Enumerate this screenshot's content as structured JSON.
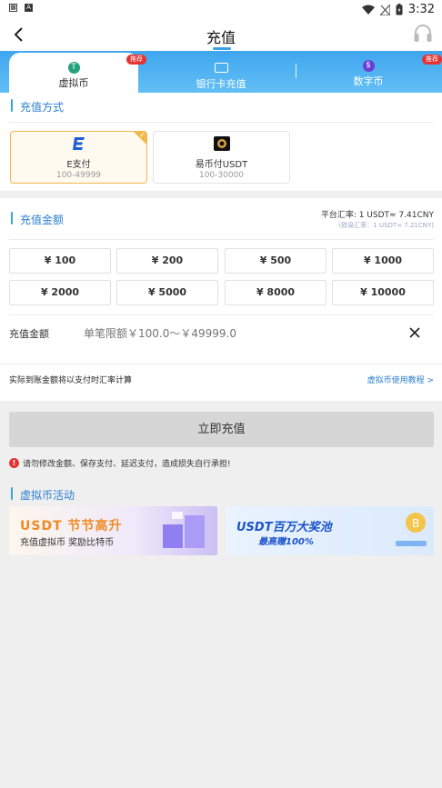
{
  "status_bar": {
    "time": "3:32"
  },
  "header": {
    "title": "充值"
  },
  "tabs": [
    {
      "label": "虚拟币",
      "icon": "tether-icon",
      "badge": "推荐",
      "active": true
    },
    {
      "label": "银行卡充值",
      "icon": "bank-card-icon"
    },
    {
      "label": "数字币",
      "icon": "dollar-coin-icon",
      "badge": "推荐"
    }
  ],
  "method_section": {
    "title": "充值方式",
    "methods": [
      {
        "name": "E支付",
        "range": "100-49999",
        "icon": "e-pay-logo",
        "selected": true
      },
      {
        "name": "易币付USDT",
        "range": "100-30000",
        "icon": "ebpay-logo",
        "selected": false
      }
    ]
  },
  "amount_section": {
    "title": "充值金额",
    "rate_line1": "平台汇率: 1 USDT≈ 7.41CNY",
    "rate_line2": "(欧易汇率：1 USDT≈ 7.21CNY)",
    "amounts": [
      "¥ 100",
      "¥ 200",
      "¥ 500",
      "¥ 1000",
      "¥ 2000",
      "¥ 5000",
      "¥ 8000",
      "¥ 10000"
    ],
    "input_label": "充值金额",
    "input_placeholder": "单笔限额￥100.0～￥49999.0",
    "note": "实际到账金额将以支付时汇率计算",
    "tutorial_link": "虚拟币使用教程 >"
  },
  "submit_label": "立即充值",
  "warning": "请勿修改金额、保存支付、延迟支付，造成损失自行承担!",
  "activity": {
    "title": "虚拟币活动",
    "banners": [
      {
        "line1": "USDT 节节高升",
        "line2": "充值虚拟币 奖励比特币"
      },
      {
        "line1": "USDT百万大奖池",
        "line2": "最高赠100%"
      }
    ]
  },
  "colors": {
    "accent": "#3aa3e8",
    "selected_border": "#f2b84b",
    "badge": "#e53333",
    "link": "#2c7fd1"
  }
}
